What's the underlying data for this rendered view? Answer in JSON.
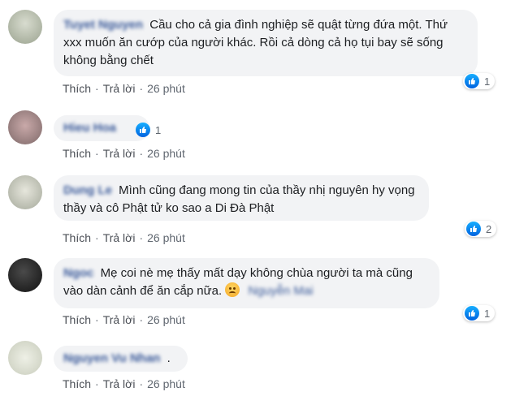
{
  "actions": {
    "like": "Thích",
    "reply": "Trả lời",
    "time": "26 phút"
  },
  "comments": [
    {
      "author": "Tuyet Nguyen",
      "text": "Cầu cho cả gia đình nghiệp sẽ quật từng đứa một. Thứ xxx muốn ăn cướp của người khác. Rồi cả dòng cả họ tụi bay sẽ sống không bằng chết",
      "likes": "1"
    },
    {
      "author": "Hieu Hoa",
      "text": "",
      "likes": "1"
    },
    {
      "author": "Dung Le",
      "text": "Mình cũng đang mong tin của thầy nhị nguyên hy vọng thầy và cô Phật tử ko sao a Di Đà Phật",
      "likes": "2"
    },
    {
      "author": "Ngoc",
      "text": "Mẹ coi nè mẹ thấy mất dạy không chùa người ta mà cũng vào dàn cảnh để ăn cắp nữa.",
      "tag": "Nguyễn Mai",
      "likes": "1"
    },
    {
      "author": "Nguyen Vu Nhan",
      "text": ".",
      "likes": ""
    }
  ],
  "icons": {
    "like": "thumbs-up-icon",
    "emoji": "frowning-face-emoji"
  },
  "colors": {
    "link": "#385898",
    "bubble": "#f2f3f5",
    "like_blue": "#1877f2"
  }
}
